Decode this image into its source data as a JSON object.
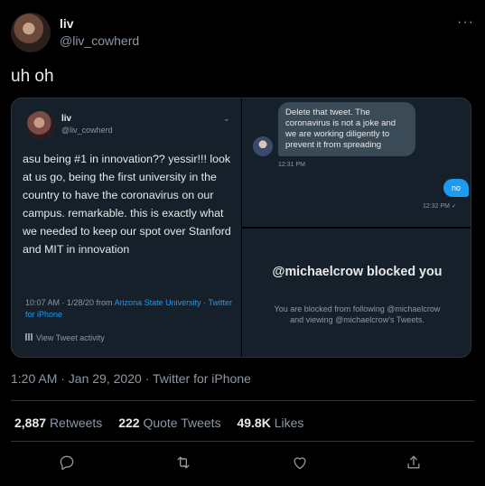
{
  "tweet": {
    "author_name": "liv",
    "author_handle": "@liv_cowherd",
    "more_label": "···",
    "text": "uh oh",
    "timestamp": "1:20 AM · Jan 29, 2020 · Twitter for iPhone"
  },
  "embedded_tweet": {
    "author_name": "liv",
    "author_handle": "@liv_cowherd",
    "chevron": "⌄",
    "body": "asu being #1 in innovation?? yessir!!! look at us go, being the first university in the country to have the coronavirus on our campus. remarkable. this is exactly what we needed to keep our spot over Stanford and MIT in innovation",
    "meta_time": "10:07 AM · 1/28/20 from ",
    "meta_place": "Arizona State University",
    "meta_client": "· Twitter for iPhone",
    "view_activity": "View Tweet activity"
  },
  "dm": {
    "incoming_text": "Delete that tweet. The coronavirus is not a joke and we are working diligently to prevent it from spreading",
    "incoming_time": "12:31 PM",
    "outgoing_text": "no",
    "outgoing_time": "12:32 PM ✓"
  },
  "blocked": {
    "title": "@michaelcrow blocked you",
    "description": "You are blocked from following @michaelcrow and viewing @michaelcrow's Tweets."
  },
  "stats": {
    "retweets_count": "2,887",
    "retweets_label": "Retweets",
    "quotes_count": "222",
    "quotes_label": "Quote Tweets",
    "likes_count": "49.8K",
    "likes_label": "Likes"
  },
  "actions": [
    "reply-icon",
    "retweet-icon",
    "like-icon",
    "share-icon"
  ],
  "colors": {
    "background": "#000000",
    "accent": "#1d9bf0",
    "muted": "#8b98a5",
    "card": "#15202b"
  }
}
